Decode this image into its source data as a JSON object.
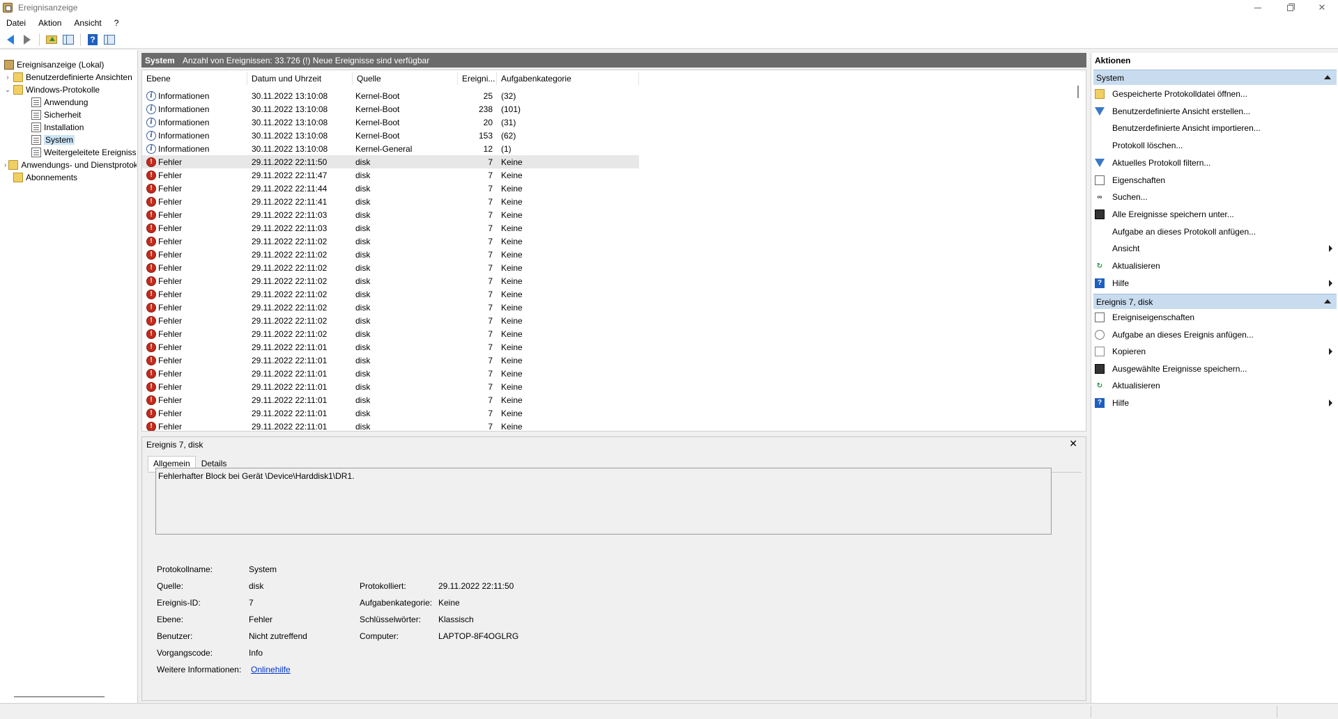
{
  "window": {
    "title": "Ereignisanzeige",
    "controls": {
      "minimize_icon": "minimize-icon",
      "maximize_icon": "restore-icon",
      "close": "✕"
    }
  },
  "menu": [
    "Datei",
    "Aktion",
    "Ansicht",
    "?"
  ],
  "tree": {
    "root": "Ereignisanzeige (Lokal)",
    "custom_views": "Benutzerdefinierte Ansichten",
    "windows_logs": "Windows-Protokolle",
    "logs": [
      "Anwendung",
      "Sicherheit",
      "Installation",
      "System",
      "Weitergeleitete Ereignisse"
    ],
    "app_service_logs": "Anwendungs- und Dienstprotokolle",
    "subscriptions": "Abonnements",
    "selected": "System"
  },
  "event_list": {
    "log_name": "System",
    "info": "Anzahl von Ereignissen: 33.726 (!) Neue Ereignisse sind verfügbar",
    "columns": [
      "Ebene",
      "Datum und Uhrzeit",
      "Quelle",
      "Ereigni...",
      "Aufgabenkategorie"
    ],
    "rows": [
      {
        "level": "Informationen",
        "type": "info",
        "date": "30.11.2022 13:10:08",
        "source": "Kernel-Boot",
        "id": "25",
        "category": "(32)"
      },
      {
        "level": "Informationen",
        "type": "info",
        "date": "30.11.2022 13:10:08",
        "source": "Kernel-Boot",
        "id": "238",
        "category": "(101)"
      },
      {
        "level": "Informationen",
        "type": "info",
        "date": "30.11.2022 13:10:08",
        "source": "Kernel-Boot",
        "id": "20",
        "category": "(31)"
      },
      {
        "level": "Informationen",
        "type": "info",
        "date": "30.11.2022 13:10:08",
        "source": "Kernel-Boot",
        "id": "153",
        "category": "(62)"
      },
      {
        "level": "Informationen",
        "type": "info",
        "date": "30.11.2022 13:10:08",
        "source": "Kernel-General",
        "id": "12",
        "category": "(1)"
      },
      {
        "level": "Fehler",
        "type": "error",
        "date": "29.11.2022 22:11:50",
        "source": "disk",
        "id": "7",
        "category": "Keine",
        "selected": true
      },
      {
        "level": "Fehler",
        "type": "error",
        "date": "29.11.2022 22:11:47",
        "source": "disk",
        "id": "7",
        "category": "Keine"
      },
      {
        "level": "Fehler",
        "type": "error",
        "date": "29.11.2022 22:11:44",
        "source": "disk",
        "id": "7",
        "category": "Keine"
      },
      {
        "level": "Fehler",
        "type": "error",
        "date": "29.11.2022 22:11:41",
        "source": "disk",
        "id": "7",
        "category": "Keine"
      },
      {
        "level": "Fehler",
        "type": "error",
        "date": "29.11.2022 22:11:03",
        "source": "disk",
        "id": "7",
        "category": "Keine"
      },
      {
        "level": "Fehler",
        "type": "error",
        "date": "29.11.2022 22:11:03",
        "source": "disk",
        "id": "7",
        "category": "Keine"
      },
      {
        "level": "Fehler",
        "type": "error",
        "date": "29.11.2022 22:11:02",
        "source": "disk",
        "id": "7",
        "category": "Keine"
      },
      {
        "level": "Fehler",
        "type": "error",
        "date": "29.11.2022 22:11:02",
        "source": "disk",
        "id": "7",
        "category": "Keine"
      },
      {
        "level": "Fehler",
        "type": "error",
        "date": "29.11.2022 22:11:02",
        "source": "disk",
        "id": "7",
        "category": "Keine"
      },
      {
        "level": "Fehler",
        "type": "error",
        "date": "29.11.2022 22:11:02",
        "source": "disk",
        "id": "7",
        "category": "Keine"
      },
      {
        "level": "Fehler",
        "type": "error",
        "date": "29.11.2022 22:11:02",
        "source": "disk",
        "id": "7",
        "category": "Keine"
      },
      {
        "level": "Fehler",
        "type": "error",
        "date": "29.11.2022 22:11:02",
        "source": "disk",
        "id": "7",
        "category": "Keine"
      },
      {
        "level": "Fehler",
        "type": "error",
        "date": "29.11.2022 22:11:02",
        "source": "disk",
        "id": "7",
        "category": "Keine"
      },
      {
        "level": "Fehler",
        "type": "error",
        "date": "29.11.2022 22:11:02",
        "source": "disk",
        "id": "7",
        "category": "Keine"
      },
      {
        "level": "Fehler",
        "type": "error",
        "date": "29.11.2022 22:11:01",
        "source": "disk",
        "id": "7",
        "category": "Keine"
      },
      {
        "level": "Fehler",
        "type": "error",
        "date": "29.11.2022 22:11:01",
        "source": "disk",
        "id": "7",
        "category": "Keine"
      },
      {
        "level": "Fehler",
        "type": "error",
        "date": "29.11.2022 22:11:01",
        "source": "disk",
        "id": "7",
        "category": "Keine"
      },
      {
        "level": "Fehler",
        "type": "error",
        "date": "29.11.2022 22:11:01",
        "source": "disk",
        "id": "7",
        "category": "Keine"
      },
      {
        "level": "Fehler",
        "type": "error",
        "date": "29.11.2022 22:11:01",
        "source": "disk",
        "id": "7",
        "category": "Keine"
      },
      {
        "level": "Fehler",
        "type": "error",
        "date": "29.11.2022 22:11:01",
        "source": "disk",
        "id": "7",
        "category": "Keine"
      },
      {
        "level": "Fehler",
        "type": "error",
        "date": "29.11.2022 22:11:01",
        "source": "disk",
        "id": "7",
        "category": "Keine"
      }
    ]
  },
  "details": {
    "title": "Ereignis 7, disk",
    "close": "✕",
    "tabs": [
      "Allgemein",
      "Details"
    ],
    "message": "Fehlerhafter Block bei Gerät \\Device\\Harddisk1\\DR1.",
    "props": {
      "log_name_label": "Protokollname:",
      "log_name": "System",
      "source_label": "Quelle:",
      "source": "disk",
      "logged_label": "Protokolliert:",
      "logged": "29.11.2022 22:11:50",
      "event_id_label": "Ereignis-ID:",
      "event_id": "7",
      "task_cat_label": "Aufgabenkategorie:",
      "task_cat": "Keine",
      "level_label": "Ebene:",
      "level": "Fehler",
      "keywords_label": "Schlüsselwörter:",
      "keywords": "Klassisch",
      "user_label": "Benutzer:",
      "user": "Nicht zutreffend",
      "computer_label": "Computer:",
      "computer": "LAPTOP-8F4OGLRG",
      "opcode_label": "Vorgangscode:",
      "opcode": "Info",
      "more_info_label": "Weitere Informationen:",
      "more_info": "Onlinehilfe"
    }
  },
  "actions": {
    "title": "Aktionen",
    "system_section": "System",
    "system_items": [
      {
        "label": "Gespeicherte Protokolldatei öffnen...",
        "icon": "folder-open-icon"
      },
      {
        "label": "Benutzerdefinierte Ansicht erstellen...",
        "icon": "filter-icon"
      },
      {
        "label": "Benutzerdefinierte Ansicht importieren...",
        "icon": ""
      },
      {
        "label": "Protokoll löschen...",
        "icon": ""
      },
      {
        "label": "Aktuelles Protokoll filtern...",
        "icon": "filter-icon"
      },
      {
        "label": "Eigenschaften",
        "icon": "properties-icon"
      },
      {
        "label": "Suchen...",
        "icon": "binoculars-icon"
      },
      {
        "label": "Alle Ereignisse speichern unter...",
        "icon": "save-icon"
      },
      {
        "label": "Aufgabe an dieses Protokoll anfügen...",
        "icon": ""
      },
      {
        "label": "Ansicht",
        "icon": "",
        "submenu": true
      },
      {
        "label": "Aktualisieren",
        "icon": "refresh-icon"
      },
      {
        "label": "Hilfe",
        "icon": "help-icon",
        "submenu": true
      }
    ],
    "event_section": "Ereignis 7, disk",
    "event_items": [
      {
        "label": "Ereigniseigenschaften",
        "icon": "properties-icon"
      },
      {
        "label": "Aufgabe an dieses Ereignis anfügen...",
        "icon": "task-icon"
      },
      {
        "label": "Kopieren",
        "icon": "copy-icon",
        "submenu": true
      },
      {
        "label": "Ausgewählte Ereignisse speichern...",
        "icon": "save-icon"
      },
      {
        "label": "Aktualisieren",
        "icon": "refresh-icon"
      },
      {
        "label": "Hilfe",
        "icon": "help-icon",
        "submenu": true
      }
    ]
  },
  "colors": {
    "header_bar": "#6b6b6b",
    "section_bg": "#c9dcef",
    "error_red": "#c42b1c",
    "link_blue": "#0033cc"
  }
}
